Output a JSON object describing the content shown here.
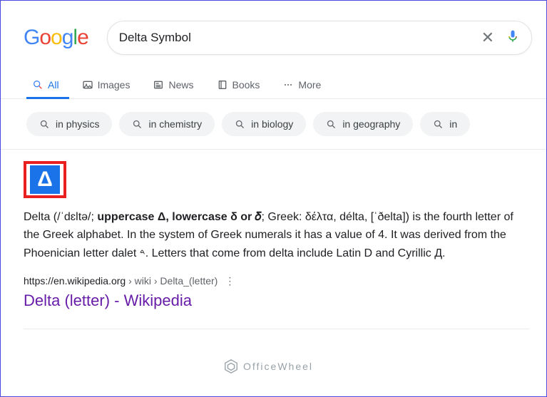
{
  "logo": {
    "g": "G",
    "o1": "o",
    "o2": "o",
    "g2": "g",
    "l": "l",
    "e": "e"
  },
  "search": {
    "value": "Delta Symbol"
  },
  "tabs": {
    "all": "All",
    "images": "Images",
    "news": "News",
    "books": "Books",
    "more": "More"
  },
  "chips": [
    "in physics",
    "in chemistry",
    "in biology",
    "in geography",
    "in"
  ],
  "thumb_glyph": "Δ",
  "snippet": {
    "pre": "Delta (/ˈdɛltə/; ",
    "bold": "uppercase Δ, lowercase δ or 𝛿",
    "post": "; Greek: δέλτα, délta, [ˈðelta]) is the fourth letter of the Greek alphabet. In the system of Greek numerals it has a value of 4. It was derived from the Phoenician letter dalet 𐤃. Letters that come from delta include Latin D and Cyrillic Д."
  },
  "result": {
    "domain": "https://en.wikipedia.org",
    "path": " › wiki › Delta_(letter)",
    "title": "Delta (letter) - Wikipedia"
  },
  "watermark": "OfficeWheel"
}
